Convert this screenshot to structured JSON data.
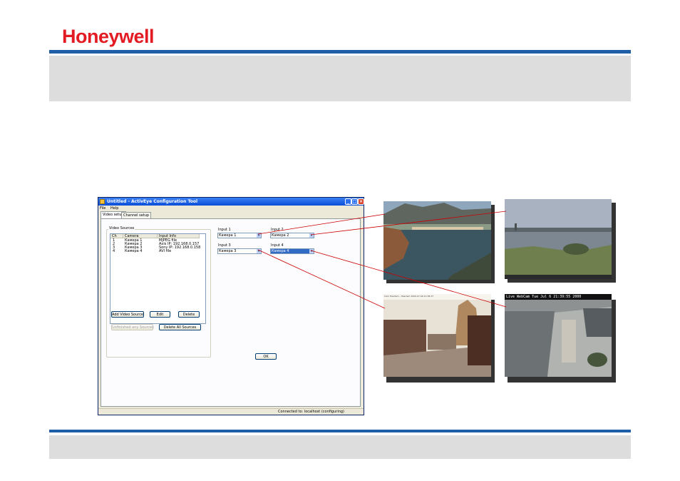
{
  "header": {
    "logo_text": "Honeywell",
    "brand_color": "#e31c23",
    "rule_color": "#1f5fa8",
    "band_color": "#dddddd"
  },
  "window": {
    "title": "Untitled - ActivEye Configuration Tool",
    "menu": [
      "File",
      "Help"
    ],
    "tabs": [
      "Video setup",
      "Channel setup"
    ],
    "group_label": "Video Sources",
    "columns": [
      "Ch",
      "Camera",
      "Input Info"
    ],
    "rows": [
      {
        "ch": "1",
        "camera": "Камера 1",
        "info": "MJPEG file"
      },
      {
        "ch": "2",
        "camera": "Камера 2",
        "info": "Axis IP: 192.168.0.157"
      },
      {
        "ch": "3",
        "camera": "Камера 3",
        "info": "Sony IP: 192.168.0.158"
      },
      {
        "ch": "4",
        "camera": "Камера 4",
        "info": "AVI file"
      }
    ],
    "buttons": {
      "add": "Add Video Source",
      "edit": "Edit",
      "delete": "Delete",
      "disabled": "Unfinished any Sources",
      "delete_all": "Delete All Sources",
      "ok": "OK"
    },
    "inputs": [
      {
        "label": "Input 1",
        "value": "Камера 1"
      },
      {
        "label": "Input 2",
        "value": "Камера 2"
      },
      {
        "label": "Input 3",
        "value": "Камера 3"
      },
      {
        "label": "Input 4",
        "value": "Камера 4",
        "selected": true
      }
    ],
    "status": "Connected to: localhost (configuring)"
  },
  "cameras": [
    {
      "scene": "harbor-town"
    },
    {
      "scene": "river-view"
    },
    {
      "scene": "town-square",
      "overlay_text": "Cam Haarlem - Haarlem 2000-07-06 21:38:37"
    },
    {
      "scene": "port-webcam",
      "overlay_text": "Live WebCam  Tue Jul 6  21:39:55  2000"
    }
  ],
  "connector_color": "#cc0000"
}
